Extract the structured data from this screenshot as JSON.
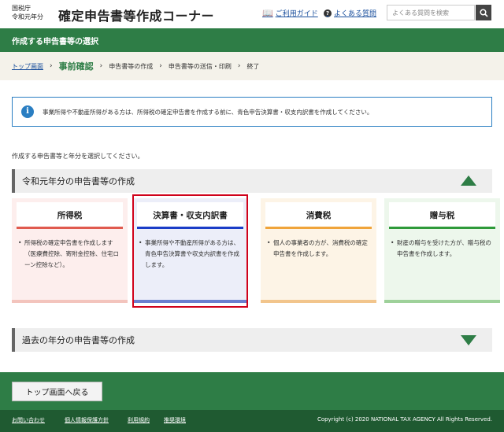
{
  "header": {
    "agency_line1": "国税庁",
    "agency_line2": "令和元年分",
    "site_title": "確定申告書等作成コーナー",
    "guide_link": "ご利用ガイド",
    "faq_link": "よくある質問",
    "search_placeholder": "よくある質問を検索"
  },
  "page_title": "作成する申告書等の選択",
  "breadcrumb": {
    "home": "トップ画面",
    "current": "事前確認",
    "steps": [
      "申告書等の作成",
      "申告書等の送信・印刷",
      "終了"
    ]
  },
  "info": {
    "icon": "i",
    "text": "事業所得や不動産所得がある方は、所得税の確定申告書を作成する前に、青色申告決算書・収支内訳書を作成してください。"
  },
  "select_prompt": "作成する申告書等と年分を選択してください。",
  "current_year_section": {
    "title": "令和元年分の申告書等の作成",
    "state": "expanded"
  },
  "cards": [
    {
      "label": "所得税",
      "description": "所得税の確定申告書を作成します（医療費控除、寄附金控除、住宅ローン控除など）。",
      "bg": "#fdeeed",
      "accent": "#e05a4e",
      "bottom": "#f3c4bd",
      "selected": false
    },
    {
      "label": "決算書・収支内訳書",
      "description": "事業所得や不動産所得がある方は、青色申告決算書や収支内訳書を作成します。",
      "bg": "#eceef9",
      "accent": "#1a3cc7",
      "bottom": "#6b7fcf",
      "selected": true
    },
    {
      "label": "消費税",
      "description": "個人の事業者の方が、消費税の確定申告書を作成します。",
      "bg": "#fdf4e6",
      "accent": "#f0a43a",
      "bottom": "#f2c58c",
      "selected": false
    },
    {
      "label": "贈与税",
      "description": "財産の贈与を受けた方が、贈与税の申告書を作成します。",
      "bg": "#edf7ec",
      "accent": "#2e9a3a",
      "bottom": "#9ed19a",
      "selected": false
    }
  ],
  "past_year_section": {
    "title": "過去の年分の申告書等の作成",
    "state": "collapsed"
  },
  "back_button": "トップ画面へ戻る",
  "footer": {
    "links": [
      "お問い合わせ",
      "個人情報保護方針",
      "利用規約",
      "推奨環境"
    ],
    "copyright": "Copyright (c) 2020 NATIONAL TAX AGENCY All Rights Reserved."
  },
  "colors": {
    "brand_green": "#2e7d46",
    "info_blue": "#2a7ec2",
    "selection_red": "#d0021b"
  }
}
